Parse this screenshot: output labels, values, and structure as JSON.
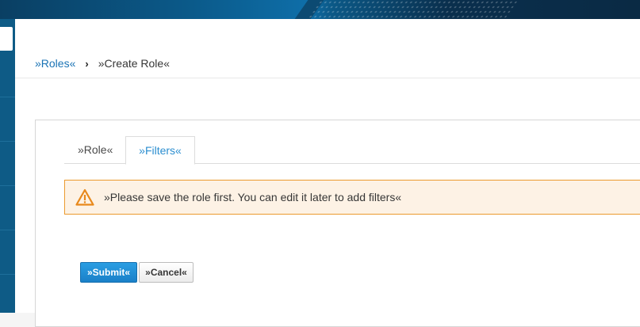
{
  "breadcrumb": {
    "roles_link": "»Roles«",
    "separator": "›",
    "current": "»Create Role«"
  },
  "tabs": [
    {
      "label": "»Role«",
      "active": false
    },
    {
      "label": "»Filters«",
      "active": true
    }
  ],
  "alert": {
    "icon": "warning-icon",
    "message": "»Please save the role first. You can edit it later to add filters«"
  },
  "buttons": {
    "submit": "»Submit«",
    "cancel": "»Cancel«"
  },
  "colors": {
    "sidebar": "#0e5b86",
    "link": "#1a73b5",
    "alert_border": "#eb9a2e",
    "alert_bg": "#fdf2e5",
    "primary_button": "#1a80c8"
  }
}
